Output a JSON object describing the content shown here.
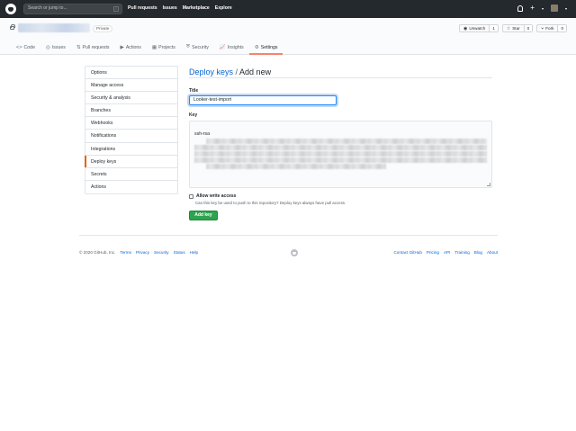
{
  "topbar": {
    "search_placeholder": "Search or jump to...",
    "search_key": "/",
    "nav": [
      "Pull requests",
      "Issues",
      "Marketplace",
      "Explore"
    ],
    "plus": "+",
    "caret": "▾"
  },
  "repo": {
    "visibility": "Private",
    "watch_label": "Unwatch",
    "watch_count": "1",
    "star_label": "Star",
    "star_count": "0",
    "fork_label": "Fork",
    "fork_count": "0"
  },
  "tabs": [
    {
      "label": "Code",
      "icon": "<>"
    },
    {
      "label": "Issues",
      "icon": "◎"
    },
    {
      "label": "Pull requests",
      "icon": "⇅"
    },
    {
      "label": "Actions",
      "icon": "▶"
    },
    {
      "label": "Projects",
      "icon": "▦"
    },
    {
      "label": "Security",
      "icon": "⛨"
    },
    {
      "label": "Insights",
      "icon": "📈"
    },
    {
      "label": "Settings",
      "icon": "⚙"
    }
  ],
  "sidebar": {
    "items": [
      "Options",
      "Manage access",
      "Security & analysis",
      "Branches",
      "Webhooks",
      "Notifications",
      "Integrations",
      "Deploy keys",
      "Secrets",
      "Actions"
    ]
  },
  "form": {
    "crumb": "Deploy keys",
    "separator": " / ",
    "heading": "Add new",
    "title_label": "Title",
    "title_value": "Looker-test-import",
    "key_label": "Key",
    "key_prefix": "ssh-rsa",
    "write_access_label": "Allow write access",
    "write_access_note": "Can this key be used to push to this repository? Deploy keys always have pull access.",
    "submit_label": "Add key"
  },
  "footer": {
    "copyright": "© 2020 GitHub, Inc.",
    "left_links": [
      "Terms",
      "Privacy",
      "Security",
      "Status",
      "Help"
    ],
    "right_links": [
      "Contact GitHub",
      "Pricing",
      "API",
      "Training",
      "Blog",
      "About"
    ]
  }
}
